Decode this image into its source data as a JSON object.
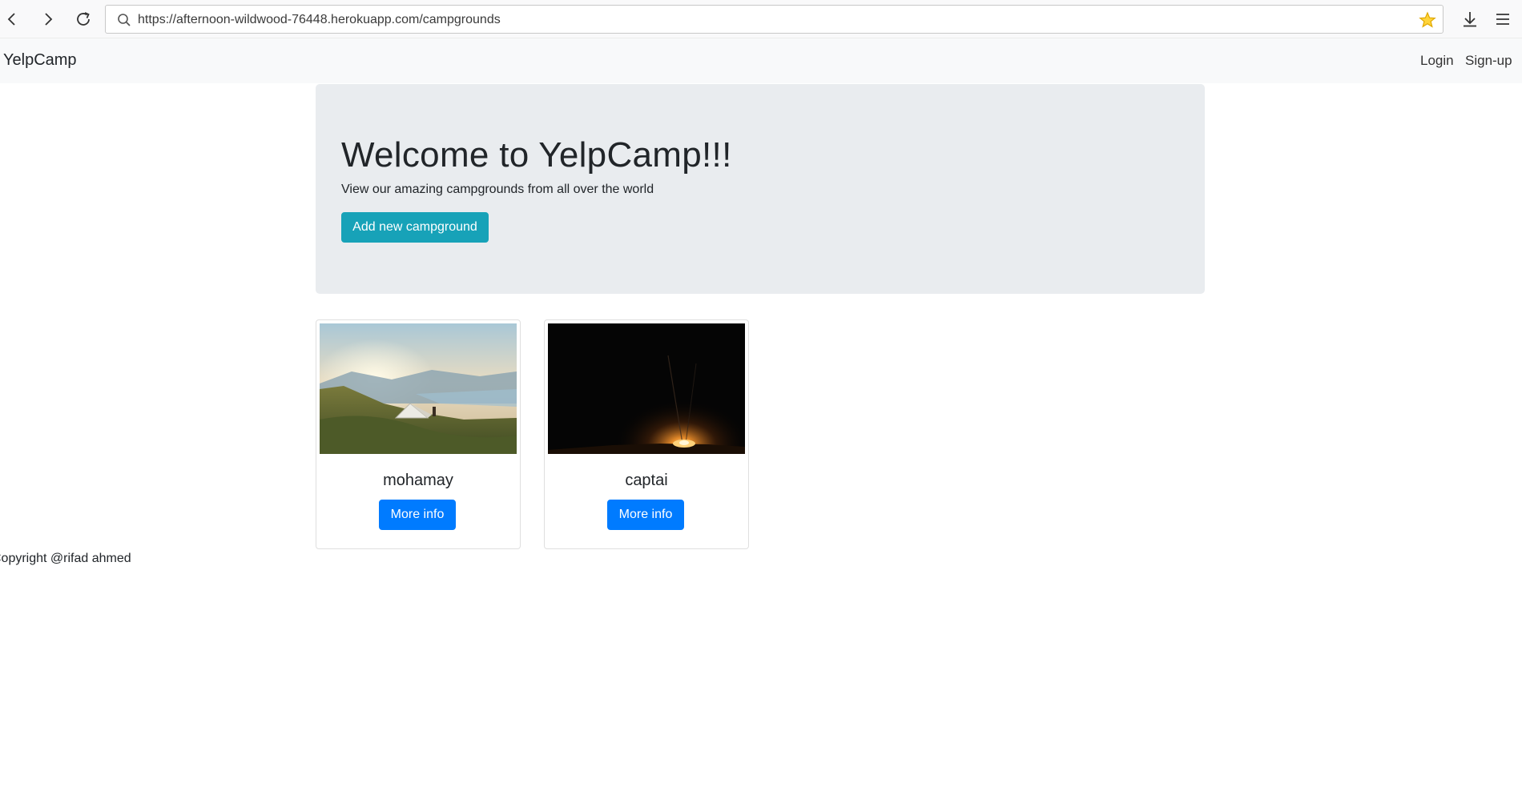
{
  "browser": {
    "url": "https://afternoon-wildwood-76448.herokuapp.com/campgrounds",
    "icons": [
      "back-icon",
      "forward-icon",
      "reload-icon",
      "search-icon",
      "bookmark-star-icon",
      "download-icon",
      "menu-icon"
    ],
    "star_color": "#f5c400"
  },
  "navbar": {
    "brand": "YelpCamp",
    "links": [
      "Login",
      "Sign-up"
    ]
  },
  "jumbotron": {
    "title": "Welcome to YelpCamp!!!",
    "lead": "View our amazing campgrounds from all over the world",
    "button_label": "Add new campground"
  },
  "campgrounds": [
    {
      "name": "mohamay",
      "button_label": "More info",
      "image": "mountain-tent-sunrise-photo"
    },
    {
      "name": "captai",
      "button_label": "More info",
      "image": "night-campfire-photo"
    }
  ],
  "footer": {
    "text": "Copyright @rifad ahmed"
  },
  "colors": {
    "info": "#17a2b8",
    "primary": "#007bff",
    "jumbotron_bg": "#e9ecef"
  }
}
